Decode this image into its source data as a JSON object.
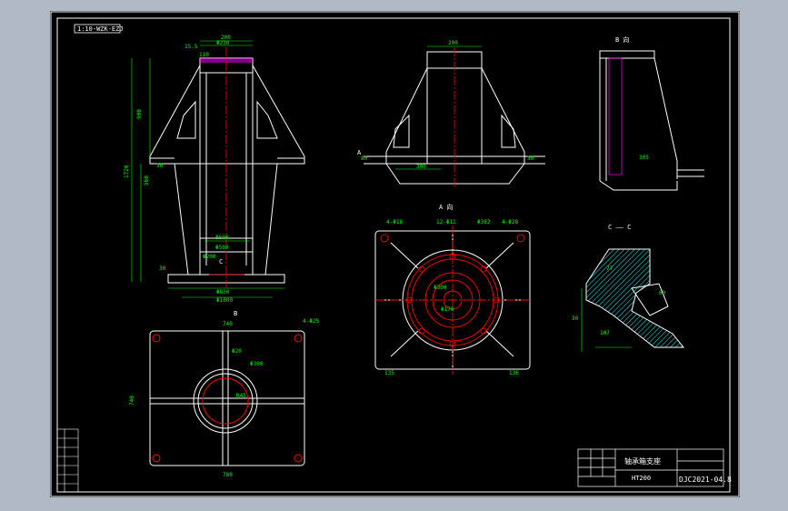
{
  "drawing": {
    "frame_tag": "1:10-WZK-EZJ",
    "section_label_a": "A",
    "section_label_b": "B",
    "section_label_c": "C",
    "view_a_title": "A  向",
    "view_b_title": "B  向",
    "section_c_title": "C  ——  C",
    "title_block": {
      "name": "轴承箱支座",
      "drawing_no": "DJC2021-04.8",
      "material": "HT200"
    },
    "dimensions": {
      "front_top_width": "200",
      "front_inner": "Φ230",
      "front_height_total": "1720",
      "front_height_upper": "900",
      "front_height_mid": "560",
      "front_base_width": "Φ830",
      "front_base_outer": "Φ1000",
      "front_mid_width": "Φ600",
      "front_bolt": "Φ200",
      "front_flange": "Φ500",
      "front_small_a": "15.5",
      "front_small_b": "110",
      "front_left_step": "30",
      "front_bottom_h": "30",
      "side_top": "200",
      "side_width_low": "300",
      "side_left_h": "80",
      "side_right_h": "30",
      "rv_depth": "305",
      "plan_width": "740",
      "plan_height": "740",
      "plan_bottom": "780",
      "plan_hole": "Φ20",
      "plan_hole_b": "4-Φ25",
      "plan_center": "Φ300",
      "plan_rad": "R45",
      "a_dim1": "4-Φ18",
      "a_dim2": "12-Φ11",
      "a_dim3": "Φ382",
      "a_dim4": "4-Φ28",
      "a_dim5": "Φ300",
      "a_dim6": "Φ170",
      "a_left": "135",
      "a_right": "136",
      "c_dim1": "77",
      "c_dim2": "60",
      "c_dim3": "107",
      "c_dim4": "30"
    }
  }
}
